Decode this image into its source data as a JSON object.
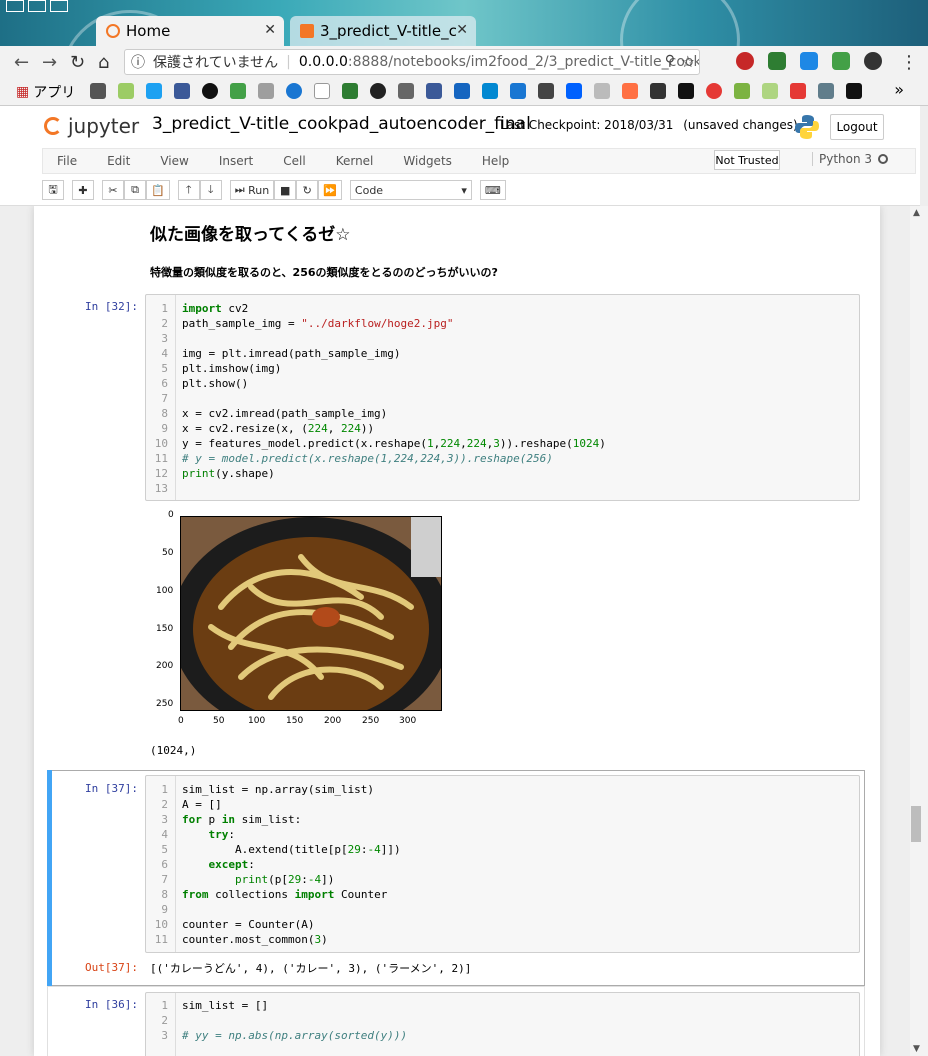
{
  "browser": {
    "tabs": [
      {
        "title": "Home",
        "active": true
      },
      {
        "title": "3_predict_V-title_c",
        "active": false
      }
    ],
    "security_label": "保護されていません",
    "url_host": "0.0.0.0",
    "url_path": ":8888/notebooks/im2food_2/3_predict_V-title_cook...",
    "bookmarks_apps_label": "アプリ",
    "bookmarks_more": "»"
  },
  "jupyter": {
    "logo_text": "jupyter",
    "notebook_title": "3_predict_V-title_cookpad_autoencoder_final",
    "checkpoint": "Last Checkpoint: 2018/03/31",
    "unsaved": "(unsaved changes)",
    "logout_label": "Logout",
    "menu": [
      "File",
      "Edit",
      "View",
      "Insert",
      "Cell",
      "Kernel",
      "Widgets",
      "Help"
    ],
    "trusted_label": "Not Trusted",
    "kernel_label": "Python 3",
    "toolbar": {
      "run_label": "Run",
      "cell_type": "Code"
    }
  },
  "notebook": {
    "heading": "似た画像を取ってくるゼ☆",
    "subheading": "特徴量の類似度を取るのと、256の類似度をとるののどっちがいいの?",
    "cell1": {
      "prompt": "In [32]:",
      "line_numbers": [
        "1",
        "2",
        "3",
        "4",
        "5",
        "6",
        "7",
        "8",
        "9",
        "10",
        "11",
        "12",
        "13"
      ],
      "output_text": "(1024,)"
    },
    "plot": {
      "y_ticks": [
        "0",
        "50",
        "100",
        "150",
        "200",
        "250"
      ],
      "x_ticks": [
        "0",
        "50",
        "100",
        "150",
        "200",
        "250",
        "300"
      ]
    },
    "cell2": {
      "prompt": "In [37]:",
      "line_numbers": [
        "1",
        "2",
        "3",
        "4",
        "5",
        "6",
        "7",
        "8",
        "9",
        "10",
        "11"
      ],
      "out_prompt": "Out[37]:",
      "output_text": "[('カレーうどん', 4), ('カレー', 3), ('ラーメン', 2)]"
    },
    "cell3": {
      "prompt": "In [36]:",
      "line_numbers": [
        "1",
        "2",
        "3"
      ]
    }
  }
}
